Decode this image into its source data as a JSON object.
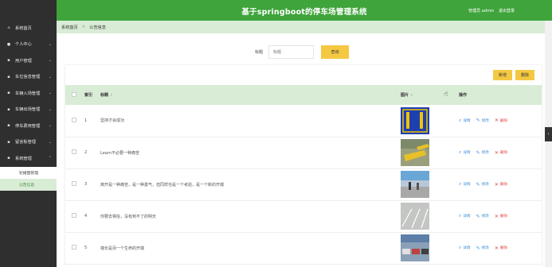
{
  "app": {
    "title": "基于springboot的停车场管理系统",
    "user_role": "管理员 admin",
    "logout": "退出登录"
  },
  "sidebar": {
    "items": [
      {
        "label": "系统首页",
        "icon": "home-icon",
        "glyph": "⌂",
        "chev": ""
      },
      {
        "label": "个人中心",
        "icon": "person-icon",
        "glyph": "●",
        "chev": "⌄"
      },
      {
        "label": "用户管理",
        "icon": "grid-icon",
        "glyph": "▪",
        "chev": "⌄"
      },
      {
        "label": "车位信息管理",
        "icon": "grid-icon",
        "glyph": "▪",
        "chev": "⌄"
      },
      {
        "label": "车辆入场管理",
        "icon": "grid-icon",
        "glyph": "▪",
        "chev": "⌄"
      },
      {
        "label": "车辆出场管理",
        "icon": "grid-icon",
        "glyph": "▪",
        "chev": "⌄"
      },
      {
        "label": "停车费用管理",
        "icon": "grid-icon",
        "glyph": "▪",
        "chev": "⌄"
      },
      {
        "label": "留言板管理",
        "icon": "grid-icon",
        "glyph": "▪",
        "chev": "⌄"
      },
      {
        "label": "系统管理",
        "icon": "grid-icon",
        "glyph": "▪",
        "chev": "⌃"
      }
    ],
    "subitems": [
      {
        "label": "轮播图管理",
        "active": false
      },
      {
        "label": "公告信息",
        "active": true
      }
    ]
  },
  "breadcrumb": {
    "home": "系统首页",
    "separator": ">",
    "current": "公告信息"
  },
  "search": {
    "label": "标题",
    "placeholder": "标题",
    "button": "查询"
  },
  "actions": {
    "add": "新增",
    "delete": "删除"
  },
  "table": {
    "headers": {
      "index": "索引",
      "title": "标题",
      "image": "图片",
      "ops": "操作"
    },
    "sort_glyph": "⇕",
    "op_labels": {
      "detail": "详情",
      "edit": "修改",
      "remove": "删除"
    },
    "rows": [
      {
        "index": "1",
        "title": "坚持才会成功",
        "image": "parking-sign"
      },
      {
        "index": "2",
        "title": "Learn不必要一种痛苦",
        "image": "parking-lot"
      },
      {
        "index": "3",
        "title": "离开是一种痛苦，是一种勇气，但同样也是一个考验，是一个新的开端",
        "image": "parking-people"
      },
      {
        "index": "4",
        "title": "你要去相信，没有到不了的明天",
        "image": "parking-empty"
      },
      {
        "index": "5",
        "title": "端长是另一个生命的开端",
        "image": "parking-cars"
      }
    ]
  },
  "colors": {
    "header_green": "#3fa43b",
    "light_green": "#d9ecd6",
    "sidebar_dark": "#2f2f2f",
    "accent_yellow": "#f5c842",
    "link_blue": "#3e8fd6",
    "danger_red": "#e04848"
  }
}
